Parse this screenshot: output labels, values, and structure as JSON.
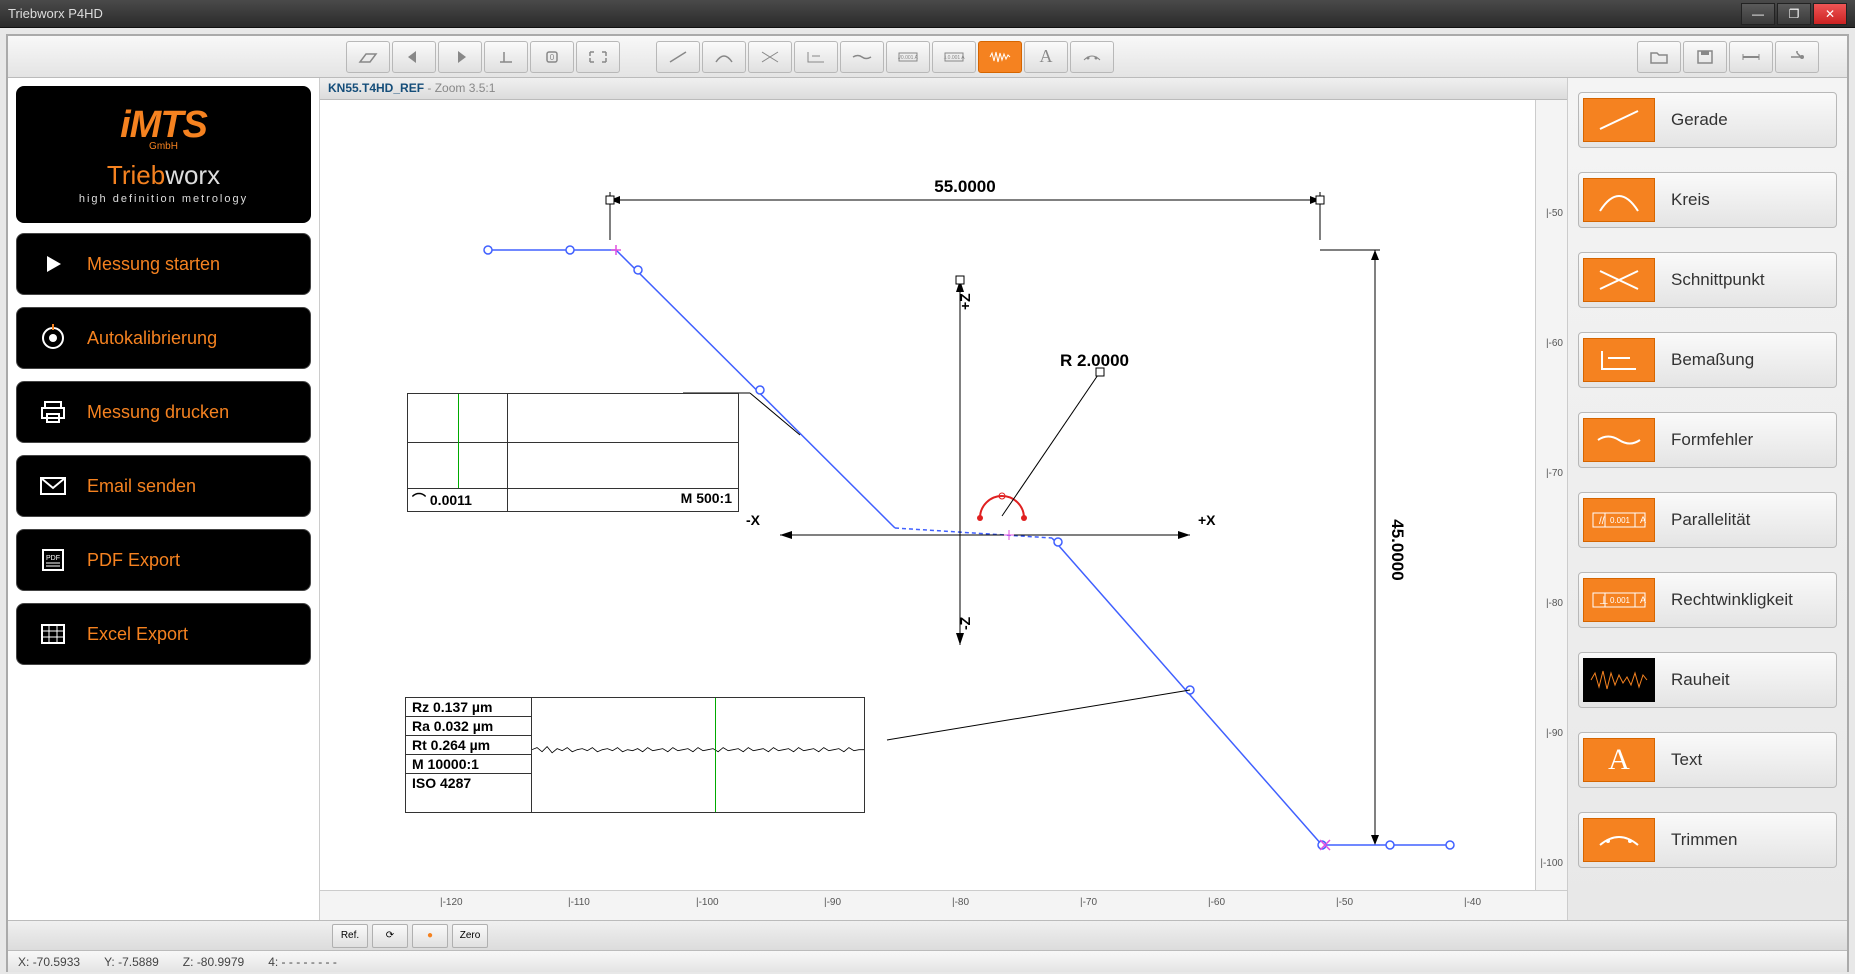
{
  "window": {
    "title": "Triebworx P4HD"
  },
  "logo": {
    "brand1": "iMTS",
    "gmbh": "GmbH",
    "brand2a": "Trieb",
    "brand2b": "worx",
    "subtitle": "high definition metrology"
  },
  "sidebar_left": [
    {
      "label": "Messung starten",
      "icon": "play"
    },
    {
      "label": "Autokalibrierung",
      "icon": "circle"
    },
    {
      "label": "Messung drucken",
      "icon": "printer"
    },
    {
      "label": "Email senden",
      "icon": "mail"
    },
    {
      "label": "PDF Export",
      "icon": "pdf"
    },
    {
      "label": "Excel Export",
      "icon": "excel"
    }
  ],
  "canvas": {
    "filename": "KN55.T4HD_REF",
    "zoom": "Zoom 3.5:1",
    "dim_horizontal": "55.0000",
    "dim_vertical": "45.0000",
    "radius": "R 2.0000",
    "axis_xpos": "+X",
    "axis_xneg": "-X",
    "axis_zpos": "+Z",
    "axis_zneg": "-Z",
    "ruler_h": [
      "|-120",
      "|-110",
      "|-100",
      "|-90",
      "|-80",
      "|-70",
      "|-60",
      "|-50",
      "|-40"
    ],
    "ruler_v": [
      "|-50",
      "|-60",
      "|-70",
      "|-80",
      "|-90",
      "|-100"
    ]
  },
  "formfehler_box": {
    "value": "0.0011",
    "scale": "M 500:1"
  },
  "roughness_box": {
    "rz": "Rz 0.137 µm",
    "ra": "Ra 0.032 µm",
    "rt": "Rt 0.264 µm",
    "scale": "M 10000:1",
    "iso": "ISO 4287"
  },
  "sidebar_right": [
    {
      "label": "Gerade",
      "icon": "line"
    },
    {
      "label": "Kreis",
      "icon": "arc"
    },
    {
      "label": "Schnittpunkt",
      "icon": "intersect"
    },
    {
      "label": "Bemaßung",
      "icon": "dimension"
    },
    {
      "label": "Formfehler",
      "icon": "formerror"
    },
    {
      "label": "Parallelität",
      "icon": "parallel"
    },
    {
      "label": "Rechtwinkligkeit",
      "icon": "perpend"
    },
    {
      "label": "Rauheit",
      "icon": "roughness",
      "dark": true
    },
    {
      "label": "Text",
      "icon": "text"
    },
    {
      "label": "Trimmen",
      "icon": "trim"
    }
  ],
  "bottom": {
    "ref": "Ref.",
    "zero": "Zero"
  },
  "status": {
    "x_label": "X:",
    "x": "-70.5933",
    "y_label": "Y:",
    "y": "-7.5889",
    "z_label": "Z:",
    "z": "-80.9979",
    "four_label": "4:",
    "four": "- - - - - - - -"
  }
}
